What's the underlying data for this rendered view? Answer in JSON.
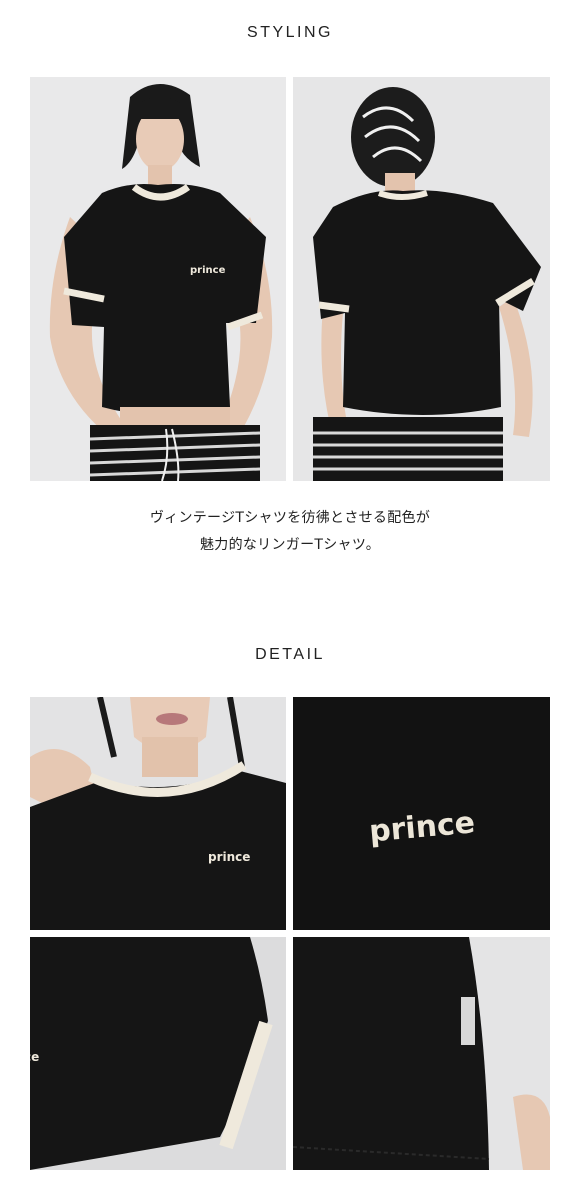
{
  "sections": {
    "styling_title": "STYLING",
    "detail_title": "DETAIL"
  },
  "caption": {
    "line1": "ヴィンテージTシャツを彷彿とさせる配色が",
    "line2": "魅力的なリンガーTシャツ。"
  },
  "shirt_logo": "prince",
  "colors": {
    "shirt": "#151515",
    "trim": "#efe9dc",
    "background": "#ffffff"
  }
}
